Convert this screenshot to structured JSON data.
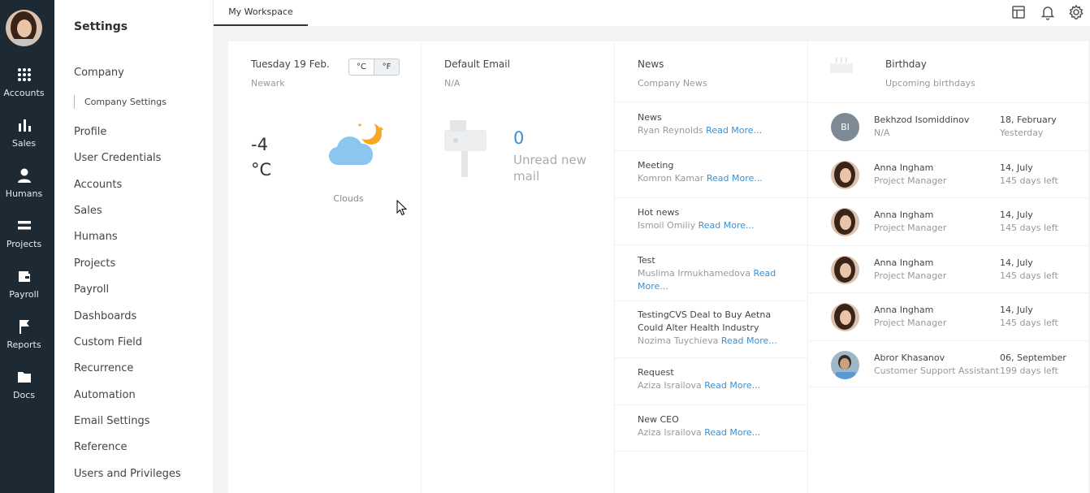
{
  "rail": {
    "items": [
      {
        "label": "Accounts",
        "icon": "grid-icon"
      },
      {
        "label": "Sales",
        "icon": "bar-chart-icon"
      },
      {
        "label": "Humans",
        "icon": "person-icon"
      },
      {
        "label": "Projects",
        "icon": "list-icon"
      },
      {
        "label": "Payroll",
        "icon": "wallet-icon"
      },
      {
        "label": "Reports",
        "icon": "flag-icon"
      },
      {
        "label": "Docs",
        "icon": "folder-icon"
      }
    ]
  },
  "settings": {
    "title": "Settings",
    "company": "Company",
    "company_settings": "Company Settings",
    "items": [
      "Profile",
      "User Credentials",
      "Accounts",
      "Sales",
      "Humans",
      "Projects",
      "Payroll",
      "Dashboards",
      "Custom Field",
      "Recurrence",
      "Automation",
      "Email Settings",
      "Reference",
      "Users and Privileges"
    ]
  },
  "topbar": {
    "tab": "My Workspace",
    "icons": [
      "layout-icon",
      "bell-icon",
      "gear-icon"
    ]
  },
  "weather": {
    "date": "Tuesday 19 Feb.",
    "city": "Newark",
    "unit_c": "°C",
    "unit_f": "°F",
    "temp_value": "-4",
    "temp_unit": "°C",
    "condition": "Clouds"
  },
  "email": {
    "title": "Default Email",
    "address": "N/A",
    "count": "0",
    "label": "Unread new mail"
  },
  "news": {
    "title": "News",
    "subtitle": "Company News",
    "read_more": "Read More...",
    "items": [
      {
        "title": "News",
        "author": "Ryan Reynolds"
      },
      {
        "title": "Meeting",
        "author": "Komron Kamar"
      },
      {
        "title": "Hot news",
        "author": "Ismoil Omiliy"
      },
      {
        "title": "Test",
        "author": "Muslima Irmukhamedova"
      },
      {
        "title": "TestingCVS Deal to Buy Aetna Could Alter Health Industry",
        "author": "Nozima Tuychieva"
      },
      {
        "title": "Request",
        "author": "Aziza Israilova"
      },
      {
        "title": "New CEO",
        "author": "Aziza Israilova"
      }
    ]
  },
  "birthday": {
    "title": "Birthday",
    "subtitle": "Upcoming birthdays",
    "items": [
      {
        "initials": "BI",
        "name": "Bekhzod Isomiddinov",
        "role": "N/A",
        "date": "18, February",
        "left": "Yesterday"
      },
      {
        "initials": "",
        "name": "Anna Ingham",
        "role": "Project Manager",
        "date": "14, July",
        "left": "145 days left"
      },
      {
        "initials": "",
        "name": "Anna Ingham",
        "role": "Project Manager",
        "date": "14, July",
        "left": "145 days left"
      },
      {
        "initials": "",
        "name": "Anna Ingham",
        "role": "Project Manager",
        "date": "14, July",
        "left": "145 days left"
      },
      {
        "initials": "",
        "name": "Anna Ingham",
        "role": "Project Manager",
        "date": "14, July",
        "left": "145 days left"
      },
      {
        "initials": "",
        "name": "Abror Khasanov",
        "role": "Customer Support Assistant",
        "date": "06, September",
        "left": "199 days left"
      }
    ]
  }
}
